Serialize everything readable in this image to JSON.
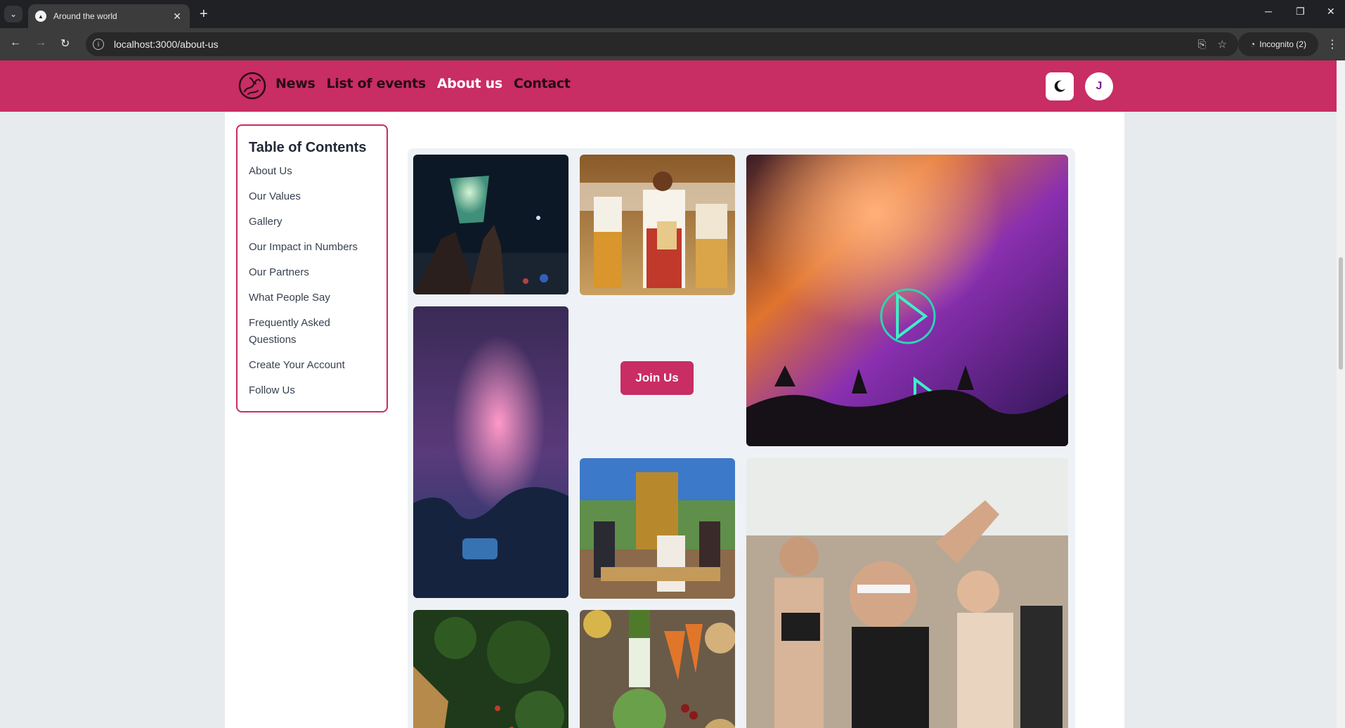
{
  "browser": {
    "tab_title": "Around the world",
    "new_tab": "+",
    "url": "localhost:3000/about-us",
    "incognito_label": "Incognito (2)"
  },
  "site": {
    "nav": [
      "News",
      "List of events",
      "About us",
      "Contact"
    ],
    "avatar_initial": "J"
  },
  "toc": {
    "title": "Table of Contents",
    "items": [
      "About Us",
      "Our Values",
      "Gallery",
      "Our Impact in Numbers",
      "Our Partners",
      "What People Say",
      "Frequently Asked Questions",
      "Create Your Account",
      "Follow Us"
    ]
  },
  "gallery": {
    "join_label": "Join Us",
    "photos": [
      "sky-lantern-photo",
      "traditional-dancers-photo",
      "concert-smoke-lights-photo",
      "fireworks-crowd-photo",
      "folk-festival-photo",
      "festival-girl-photo",
      "garden-photo",
      "vegetables-photo"
    ]
  },
  "colors": {
    "brand": "#c82d63",
    "header_text": "#2a0a18"
  }
}
